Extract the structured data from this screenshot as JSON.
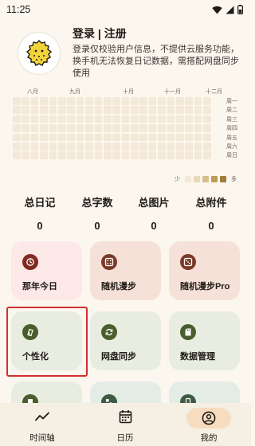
{
  "status_bar": {
    "time": "11:25"
  },
  "profile": {
    "title": "登录 | 注册",
    "description": "登录仅校验用户信息，不提供云服务功能，换手机无法恢复日记数据，需搭配网盘同步使用"
  },
  "heatmap": {
    "months": [
      "八月",
      "九月",
      "十月",
      "十一月",
      "十二月"
    ],
    "weekdays": [
      "周一",
      "周二",
      "周三",
      "周四",
      "周五",
      "周六",
      "周日"
    ],
    "legend_less": "少",
    "legend_more": "多",
    "legend_colors": [
      "#f4e8d8",
      "#ecd9b8",
      "#d9bd8a",
      "#bf9b5a",
      "#a07c36"
    ]
  },
  "stats": [
    {
      "label": "总日记",
      "value": "0"
    },
    {
      "label": "总字数",
      "value": "0"
    },
    {
      "label": "总图片",
      "value": "0"
    },
    {
      "label": "总附件",
      "value": "0"
    }
  ],
  "cards": [
    {
      "label": "那年今日",
      "icon": "history-icon"
    },
    {
      "label": "随机漫步",
      "icon": "dice-icon"
    },
    {
      "label": "随机漫步Pro",
      "icon": "dice-icon"
    },
    {
      "label": "个性化",
      "icon": "palette-icon"
    },
    {
      "label": "网盘同步",
      "icon": "sync-icon"
    },
    {
      "label": "数据管理",
      "icon": "sd-card-icon"
    }
  ],
  "bottom_nav": [
    {
      "label": "时间轴",
      "icon": "timeline-icon"
    },
    {
      "label": "日历",
      "icon": "calendar-icon"
    },
    {
      "label": "我的",
      "icon": "person-icon"
    }
  ]
}
